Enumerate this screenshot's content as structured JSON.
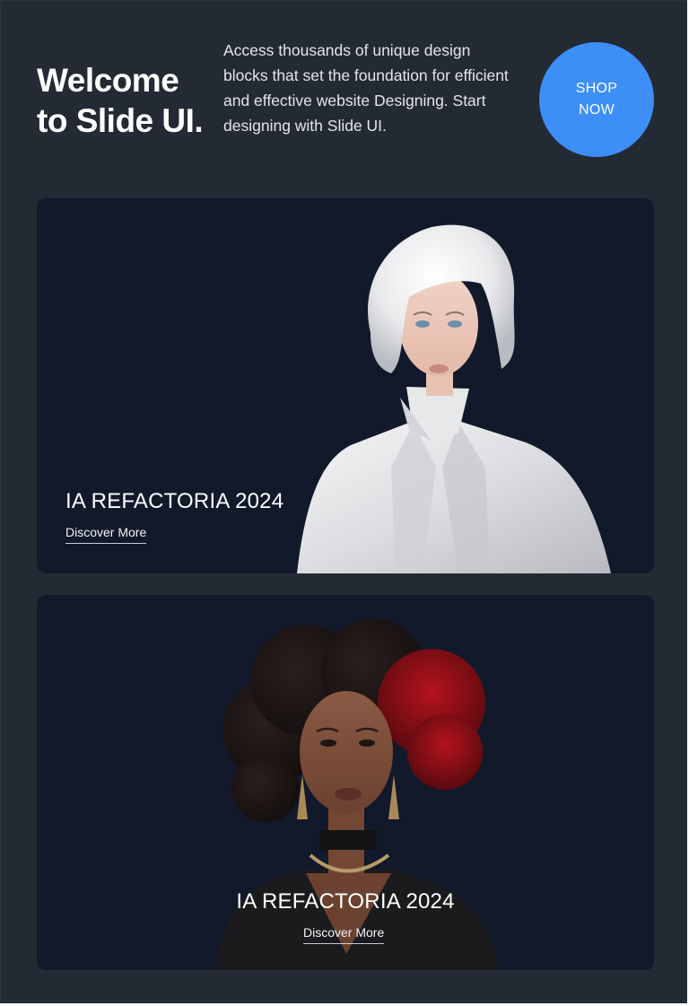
{
  "hero": {
    "title": "Welcome\nto Slide UI.",
    "description": "Access thousands of unique design blocks that set the foundation for efficient and effective website Designing. Start designing with Slide UI.",
    "cta_label": "SHOP\nNOW"
  },
  "cards": [
    {
      "title": "IA REFACTORIA 2024",
      "link_label": "Discover More",
      "image": "portrait-platinum-bob-white-satin-jacket"
    },
    {
      "title": "IA REFACTORIA 2024",
      "link_label": "Discover More",
      "image": "portrait-curly-hair-red-highlights-black-top"
    }
  ],
  "colors": {
    "page_background": "#232a33",
    "card_background": "#12192b",
    "accent": "#3e8ef7",
    "text": "#ffffff"
  }
}
